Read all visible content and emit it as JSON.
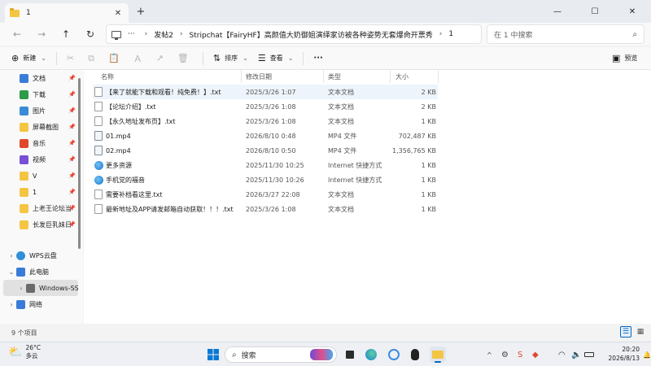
{
  "window": {
    "tab_label": "1",
    "tab_close": "✕",
    "new_tab": "+",
    "controls": {
      "minimize": "—",
      "maximize": "☐",
      "close": "✕"
    }
  },
  "nav": {
    "back": "←",
    "forward": "→",
    "up": "↑",
    "refresh": "↻",
    "more": "···",
    "breadcrumbs": [
      "发帖2",
      "Stripchat【FairyHF】高颜值大奶御姐演绎家访被各种姿势无套爆肏开票秀",
      "1"
    ],
    "search_placeholder": "在 1 中搜索"
  },
  "toolbar": {
    "new_label": "新建",
    "sort_label": "排序",
    "view_label": "查看",
    "more_label": "···",
    "preview_label": "预览"
  },
  "sidebar": {
    "items": [
      {
        "label": "文档",
        "pinned": true
      },
      {
        "label": "下载",
        "pinned": true
      },
      {
        "label": "图片",
        "pinned": true
      },
      {
        "label": "屏幕截图",
        "pinned": true
      },
      {
        "label": "音乐",
        "pinned": true
      },
      {
        "label": "视频",
        "pinned": true
      },
      {
        "label": "V",
        "pinned": true
      },
      {
        "label": "1",
        "pinned": true
      },
      {
        "label": "上老王论坛当",
        "pinned": true
      },
      {
        "label": "长发巨乳妹日",
        "pinned": true
      }
    ],
    "groups": [
      {
        "label": "WPS云盘",
        "chevron": "›"
      },
      {
        "label": "此电脑",
        "chevron": "⌄"
      },
      {
        "label": "Windows-SSD",
        "chevron": "›"
      },
      {
        "label": "网络",
        "chevron": "›"
      }
    ],
    "pin_glyph": "📌"
  },
  "columns": {
    "name": "名称",
    "modified": "修改日期",
    "type": "类型",
    "size": "大小"
  },
  "files": [
    {
      "name": "【来了就能下载和观看！纯免费！】.txt",
      "modified": "2025/3/26 1:07",
      "type": "文本文档",
      "size": "2 KB",
      "kind": "txt"
    },
    {
      "name": "【论坛介绍】.txt",
      "modified": "2025/3/26 1:08",
      "type": "文本文档",
      "size": "2 KB",
      "kind": "txt"
    },
    {
      "name": "【永久地址发布页】.txt",
      "modified": "2025/3/26 1:08",
      "type": "文本文档",
      "size": "1 KB",
      "kind": "txt"
    },
    {
      "name": "01.mp4",
      "modified": "2026/8/10 0:48",
      "type": "MP4 文件",
      "size": "702,487 KB",
      "kind": "mp4"
    },
    {
      "name": "02.mp4",
      "modified": "2026/8/10 0:50",
      "type": "MP4 文件",
      "size": "1,356,765 KB",
      "kind": "mp4"
    },
    {
      "name": "更多资源",
      "modified": "2025/11/30 10:25",
      "type": "Internet 快捷方式",
      "size": "1 KB",
      "kind": "url"
    },
    {
      "name": "手机党的福音",
      "modified": "2025/11/30 10:26",
      "type": "Internet 快捷方式",
      "size": "1 KB",
      "kind": "url"
    },
    {
      "name": "需要补档看这里.txt",
      "modified": "2026/3/27 22:08",
      "type": "文本文档",
      "size": "1 KB",
      "kind": "txt"
    },
    {
      "name": "最新地址及APP请发邮箱自动获取！！！.txt",
      "modified": "2025/3/26 1:08",
      "type": "文本文档",
      "size": "1 KB",
      "kind": "txt"
    }
  ],
  "status": {
    "item_count": "9 个项目"
  },
  "taskbar": {
    "weather_temp": "26°C",
    "weather_desc": "多云",
    "search_label": "搜索",
    "tray_expand": "^",
    "time": "20:20",
    "date": "2026/8/13"
  },
  "colors": {
    "accent": "#0067c0",
    "folder": "#f4c542",
    "selected_row": "#eef4fb"
  }
}
